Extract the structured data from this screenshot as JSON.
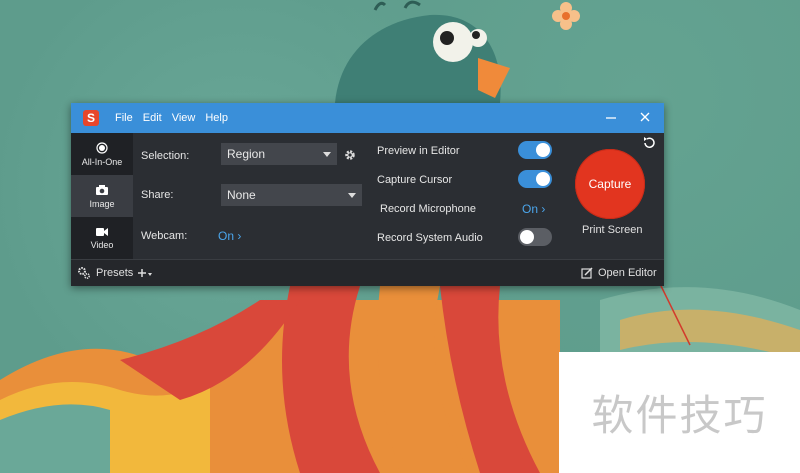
{
  "window": {
    "menu": [
      "File",
      "Edit",
      "View",
      "Help"
    ],
    "logo_letter": "S"
  },
  "modes": [
    {
      "label": "All-In-One",
      "icon": "record-dot-icon",
      "active": false
    },
    {
      "label": "Image",
      "icon": "camera-icon",
      "active": true
    },
    {
      "label": "Video",
      "icon": "video-camera-icon",
      "active": false
    }
  ],
  "settings": {
    "selection_label": "Selection:",
    "selection_value": "Region",
    "share_label": "Share:",
    "share_value": "None",
    "webcam_label": "Webcam:",
    "webcam_value": "On"
  },
  "options": {
    "preview_label": "Preview in Editor",
    "preview_on": true,
    "cursor_label": "Capture Cursor",
    "cursor_on": true,
    "mic_label": "Record Microphone",
    "mic_value": "On",
    "audio_label": "Record System Audio",
    "audio_on": false
  },
  "capture": {
    "button_label": "Capture",
    "hotkey": "Print Screen"
  },
  "bottom": {
    "presets_label": "Presets",
    "open_editor_label": "Open Editor"
  },
  "watermark": "软件技巧",
  "colors": {
    "accent": "#3a8fd9",
    "capture": "#e2351f",
    "link": "#4ba6ec"
  }
}
